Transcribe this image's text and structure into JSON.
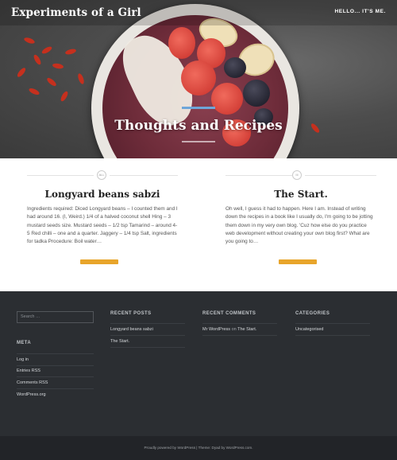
{
  "site": {
    "title": "Experiments of a Girl",
    "nav": "HELLO... IT'S ME."
  },
  "hero": {
    "title": "Thoughts and Recipes"
  },
  "posts": [
    {
      "marker": "ALL",
      "title": "Longyard beans sabzi",
      "excerpt": "Ingredients required: Diced Longyard beans – I counted them and I had around 16. (I, Weird.) 1/4 of a halved coconut shell Hing – 3 mustard seeds size. Mustard seeds – 1/2 tsp Tamarind – around 4-5 Red chilli – one and a quarter. Jaggery – 1/4 tsp Salt, ingredients for tadka Procedure: Boil water…"
    },
    {
      "marker": "III",
      "title": "The Start.",
      "excerpt": "Oh well, I guess it had to happen. Here I am. Instead of writing down the recipes in a book like I usually do, I'm going to be jotting them down in my very own blog. 'Cuz how else do you practice web development without creating your own blog first? What are you going to…"
    }
  ],
  "footer": {
    "search_placeholder": "Search …",
    "meta": {
      "heading": "META",
      "items": [
        "Log in",
        "Entries RSS",
        "Comments RSS",
        "WordPress.org"
      ]
    },
    "recent_posts": {
      "heading": "RECENT POSTS",
      "items": [
        "Longyard beans sabzi",
        "The Start."
      ]
    },
    "recent_comments": {
      "heading": "RECENT COMMENTS",
      "author": "Mr WordPress",
      "on": "on",
      "post": "The Start."
    },
    "categories": {
      "heading": "CATEGORIES",
      "items": [
        "Uncategorised"
      ]
    },
    "credit": "Proudly powered by WordPress | Theme: Dyad by WordPress.com."
  },
  "colors": {
    "accent": "#e8a52b",
    "footer_bg": "#2b2e32",
    "hero_rule": "#6ea6d9"
  }
}
